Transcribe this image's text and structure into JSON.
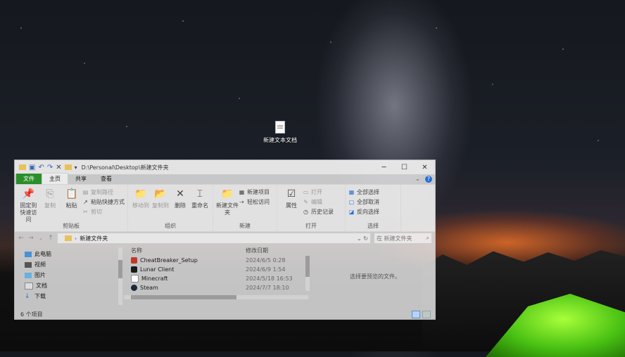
{
  "desktop": {
    "icon_label": "新建文本文档"
  },
  "window": {
    "title_path": "D:\\Personal\\Desktop\\新建文件夹",
    "controls": {
      "minimize": "─",
      "maximize": "☐",
      "close": "✕"
    },
    "tabs": {
      "file": "文件",
      "home": "主页",
      "share": "共享",
      "view": "查看"
    }
  },
  "ribbon": {
    "clipboard": {
      "caption": "剪贴板",
      "pin": "固定到快速访问",
      "copy": "复制",
      "paste": "粘贴",
      "copy_path": "复制路径",
      "paste_shortcut": "粘贴快捷方式",
      "cut": "剪切"
    },
    "organize": {
      "caption": "组织",
      "move_to": "移动到",
      "copy_to": "复制到",
      "delete": "删除",
      "rename": "重命名"
    },
    "new": {
      "caption": "新建",
      "new_folder": "新建文件夹",
      "new_item": "新建项目",
      "easy_access": "轻松访问"
    },
    "open": {
      "caption": "打开",
      "properties": "属性",
      "open": "打开",
      "edit": "编辑",
      "history": "历史记录"
    },
    "select": {
      "caption": "选择",
      "select_all": "全部选择",
      "select_none": "全部取消",
      "invert": "反向选择"
    }
  },
  "address": {
    "path": "新建文件夹",
    "search_placeholder": "在 新建文件夹"
  },
  "nav_pane": {
    "items": [
      "此电脑",
      "视频",
      "图片",
      "文档",
      "下载"
    ]
  },
  "file_list": {
    "headers": {
      "name": "名称",
      "modified": "修改日期"
    },
    "rows": [
      {
        "name": "CheatBreaker_Setup",
        "modified": "2024/6/5 0:28",
        "color": "#c0392b"
      },
      {
        "name": "Lunar Client",
        "modified": "2024/6/9 1:54",
        "color": "#1a1a1a"
      },
      {
        "name": "Minecraft",
        "modified": "2024/5/18 16:53",
        "color": "#ffffff"
      },
      {
        "name": "Steam",
        "modified": "2024/7/7 18:10",
        "color": "#1b2838"
      }
    ]
  },
  "preview": {
    "text": "选择要预览的文件。"
  },
  "status": {
    "count": "6 个项目"
  }
}
